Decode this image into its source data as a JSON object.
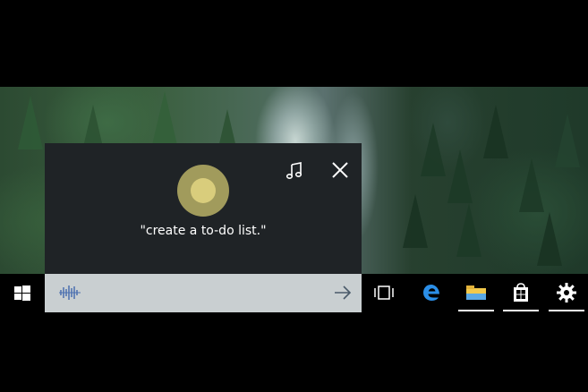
{
  "cortana": {
    "query_text": "\"create a to-do list.\"",
    "orb_color": "#d9cd7c",
    "panel_color": "#1f2326"
  },
  "icons": {
    "music": "music-note-icon",
    "close": "close-icon",
    "start": "windows-logo-icon",
    "listening": "voice-wave-icon",
    "submit": "arrow-right-icon",
    "task_view": "task-view-icon",
    "edge": "edge-browser-icon",
    "explorer": "file-explorer-icon",
    "store": "store-icon",
    "settings": "gear-icon"
  },
  "taskbar": {
    "background": "#000000",
    "search_background": "#c9cfd1",
    "accent": "#1e90ff",
    "pinned": [
      "task-view",
      "edge",
      "file-explorer",
      "store",
      "settings"
    ]
  }
}
